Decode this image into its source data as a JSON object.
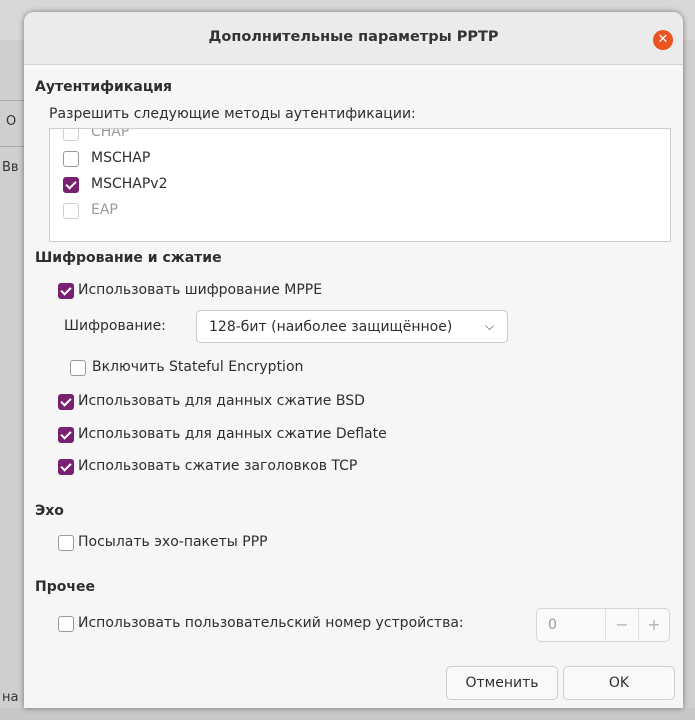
{
  "background": {
    "fragments": [
      "О",
      "Вв",
      "на"
    ]
  },
  "dialog": {
    "title": "Дополнительные параметры PPTP",
    "close_icon": "close-icon",
    "colors": {
      "accent": "#77216f",
      "close": "#e95420"
    }
  },
  "authentication": {
    "heading": "Аутентификация",
    "prompt": "Разрешить следующие методы аутентификации:",
    "methods": [
      {
        "label": "CHAP",
        "checked": false,
        "enabled": false
      },
      {
        "label": "MSCHAP",
        "checked": false,
        "enabled": true
      },
      {
        "label": "MSCHAPv2",
        "checked": true,
        "enabled": true
      },
      {
        "label": "EAP",
        "checked": false,
        "enabled": false
      }
    ]
  },
  "encryption": {
    "heading": "Шифрование и сжатие",
    "use_mppe": {
      "label": "Использовать шифрование MPPE",
      "checked": true
    },
    "cipher_label": "Шифрование:",
    "cipher_value": "128-бит (наиболее защищённое)",
    "stateful": {
      "label": "Включить Stateful Encryption",
      "checked": false
    },
    "bsd": {
      "label": "Использовать для данных сжатие BSD",
      "checked": true
    },
    "deflate": {
      "label": "Использовать для данных сжатие Deflate",
      "checked": true
    },
    "tcp": {
      "label": "Использовать сжатие заголовков TCP",
      "checked": true
    }
  },
  "echo": {
    "heading": "Эхо",
    "send_ppp": {
      "label": "Посылать эхо-пакеты PPP",
      "checked": false
    }
  },
  "misc": {
    "heading": "Прочее",
    "custom_unit": {
      "label": "Использовать пользовательский номер устройства:",
      "checked": false
    },
    "unit_value": "0",
    "minus": "−",
    "plus": "+"
  },
  "buttons": {
    "cancel": "Отменить",
    "ok": "OK"
  }
}
